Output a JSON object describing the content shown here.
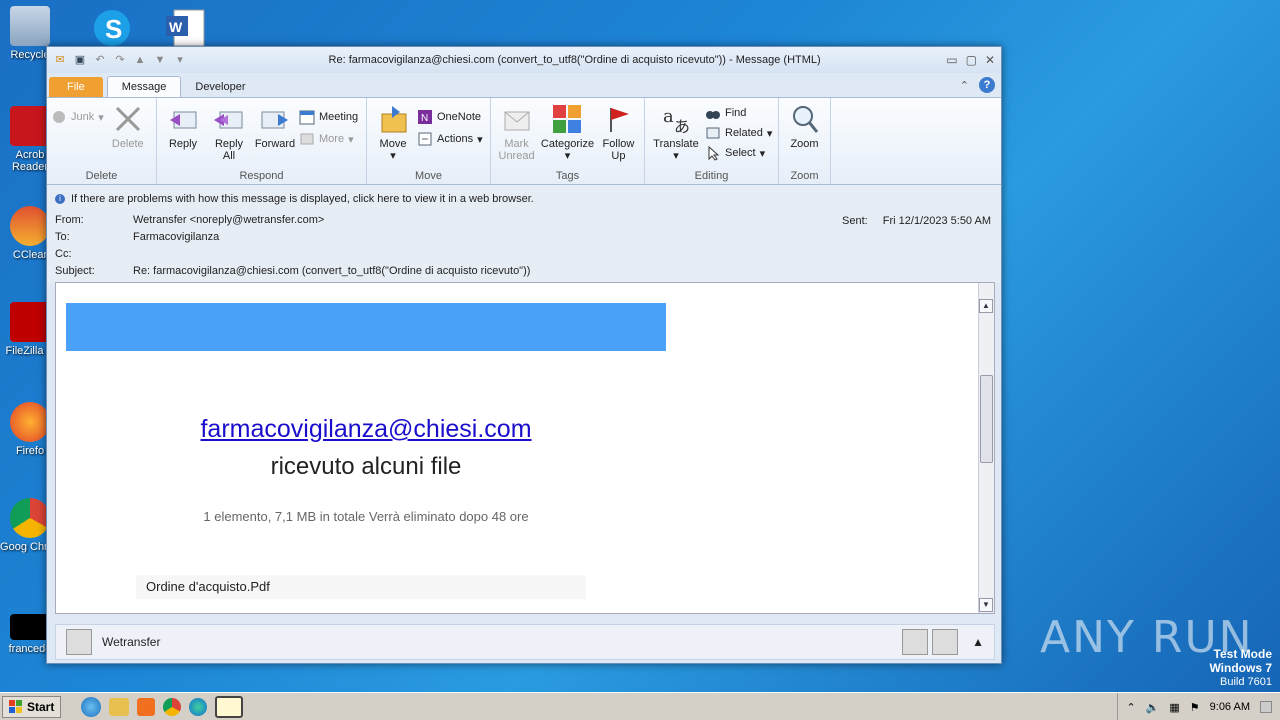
{
  "desktop": {
    "icons": [
      {
        "label": "Recycle",
        "name": "recycle-bin-icon"
      },
      {
        "label": "Acrob Reader",
        "name": "acrobat-reader-icon"
      },
      {
        "label": "CClear",
        "name": "ccleaner-icon"
      },
      {
        "label": "FileZilla C",
        "name": "filezilla-icon"
      },
      {
        "label": "Firefo",
        "name": "firefox-icon"
      },
      {
        "label": "Goog Chron",
        "name": "chrome-icon"
      },
      {
        "label": "francede",
        "name": "file-icon"
      }
    ]
  },
  "window": {
    "title": "Re: farmacovigilanza@chiesi.com (convert_to_utf8(\"Ordine di acquisto ricevuto\")) - Message (HTML)",
    "tabs": [
      "File",
      "Message",
      "Developer"
    ],
    "active_tab": "Message"
  },
  "ribbon": {
    "delete_group": {
      "label": "Delete",
      "junk": "Junk",
      "delete": "Delete"
    },
    "respond_group": {
      "label": "Respond",
      "reply": "Reply",
      "reply_all_1": "Reply",
      "reply_all_2": "All",
      "forward": "Forward",
      "meeting": "Meeting",
      "more": "More"
    },
    "move_group": {
      "label": "Move",
      "move": "Move",
      "onenote": "OneNote",
      "actions": "Actions"
    },
    "tags_group": {
      "label": "Tags",
      "mark_unread_1": "Mark",
      "mark_unread_2": "Unread",
      "categorize": "Categorize",
      "follow_up_1": "Follow",
      "follow_up_2": "Up"
    },
    "editing_group": {
      "label": "Editing",
      "translate": "Translate",
      "find": "Find",
      "related": "Related",
      "select": "Select"
    },
    "zoom_group": {
      "label": "Zoom",
      "zoom": "Zoom"
    }
  },
  "header": {
    "infobar": "If there are problems with how this message is displayed, click here to view it in a web browser.",
    "from_label": "From:",
    "from": "Wetransfer <noreply@wetransfer.com>",
    "to_label": "To:",
    "to": "Farmacovigilanza",
    "cc_label": "Cc:",
    "subject_label": "Subject:",
    "subject": "Re: farmacovigilanza@chiesi.com (convert_to_utf8(\"Ordine di acquisto ricevuto\"))",
    "sent_label": "Sent:",
    "sent": "Fri 12/1/2023 5:50 AM"
  },
  "message": {
    "banner_color": "#4aa2f8",
    "email_link": "farmacovigilanza@chiesi.com",
    "received": "ricevuto alcuni file",
    "meta": "1 elemento, 7,1 MB in totale Verrà eliminato dopo 48 ore",
    "file_name": "Ordine d'acquisto.Pdf"
  },
  "people_pane": {
    "name": "Wetransfer"
  },
  "taskbar": {
    "start": "Start",
    "clock": "9:06 AM"
  },
  "watermark": {
    "line1": "Test Mode",
    "line2": "Windows 7",
    "line3": "Build 7601",
    "brand": "ANY RUN"
  }
}
